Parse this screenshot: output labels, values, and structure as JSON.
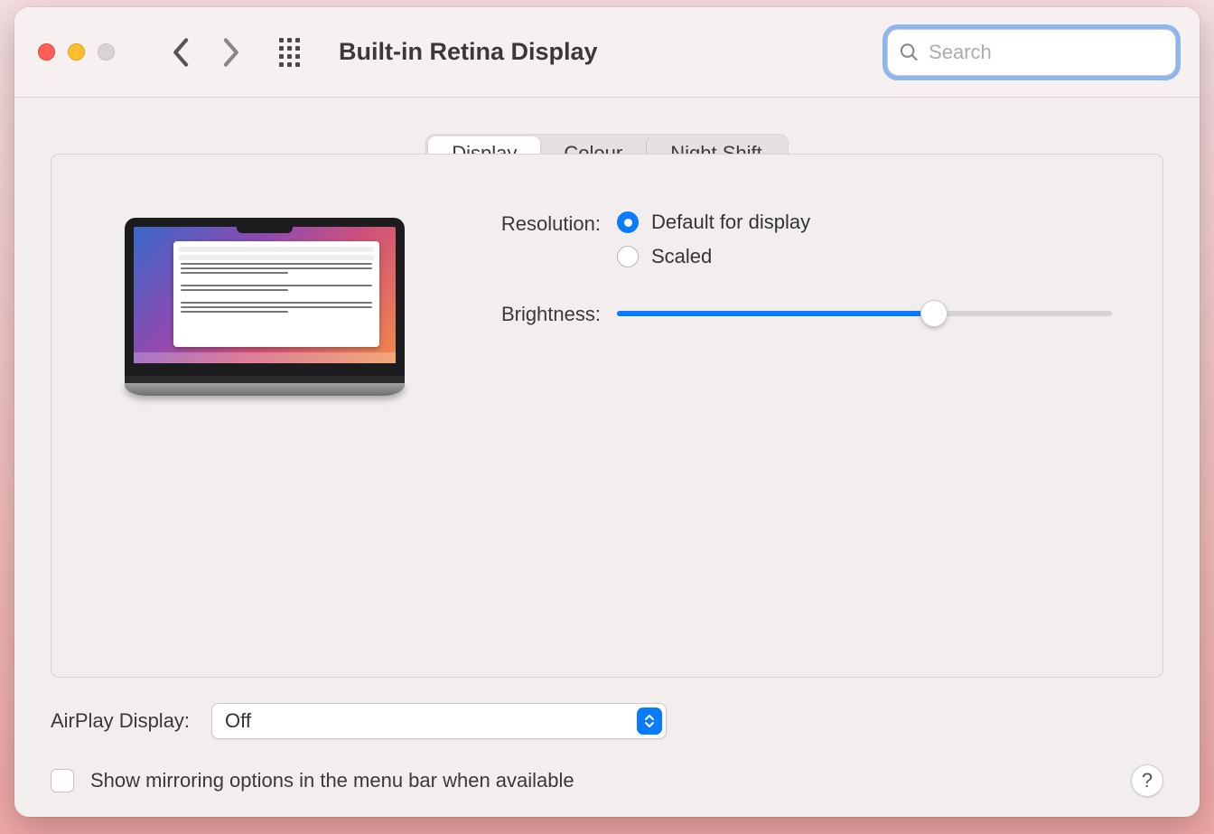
{
  "header": {
    "title": "Built-in Retina Display",
    "search_placeholder": "Search"
  },
  "tabs": {
    "display": "Display",
    "colour": "Colour",
    "night_shift": "Night Shift"
  },
  "settings": {
    "resolution_label": "Resolution:",
    "resolution_default": "Default for display",
    "resolution_scaled": "Scaled",
    "brightness_label": "Brightness:",
    "brightness_value": 64
  },
  "footer": {
    "airplay_label": "AirPlay Display:",
    "airplay_value": "Off",
    "mirroring_label": "Show mirroring options in the menu bar when available",
    "help": "?"
  }
}
